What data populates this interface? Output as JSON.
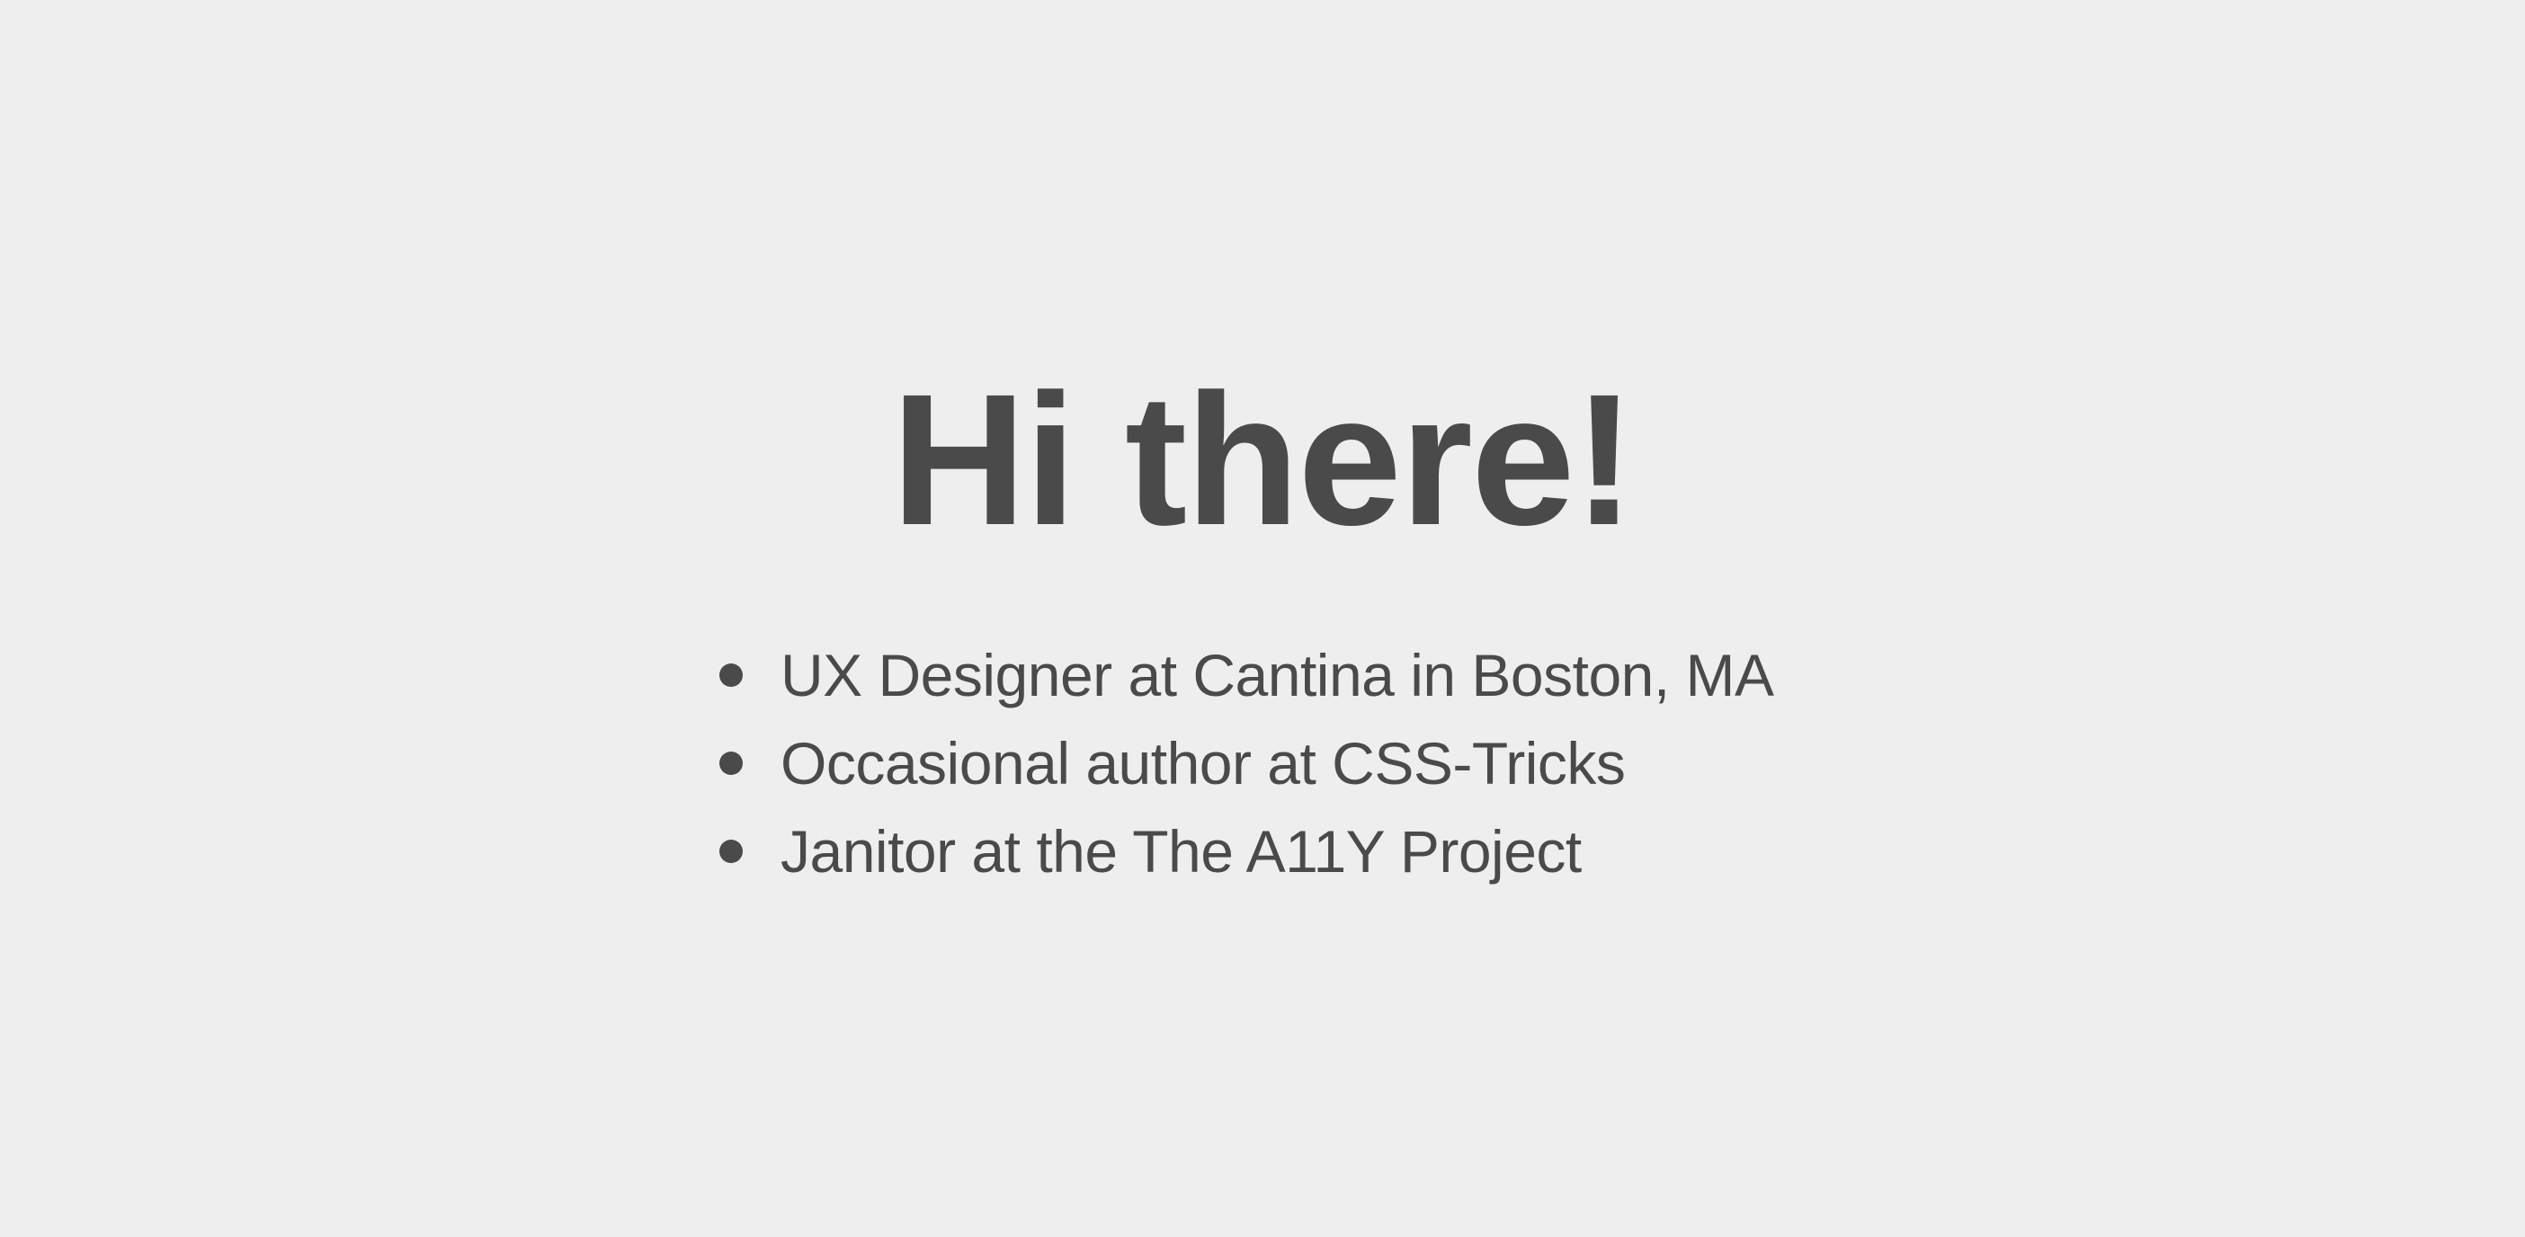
{
  "page": {
    "heading": "Hi there!",
    "bio": [
      {
        "text": "UX Designer at Cantina in Boston, MA"
      },
      {
        "text": "Occasional author at CSS-Tricks"
      },
      {
        "text": "Janitor at the The A11Y Project"
      }
    ]
  },
  "colors": {
    "background": "#eeeeee",
    "text": "#4a4a4a"
  }
}
